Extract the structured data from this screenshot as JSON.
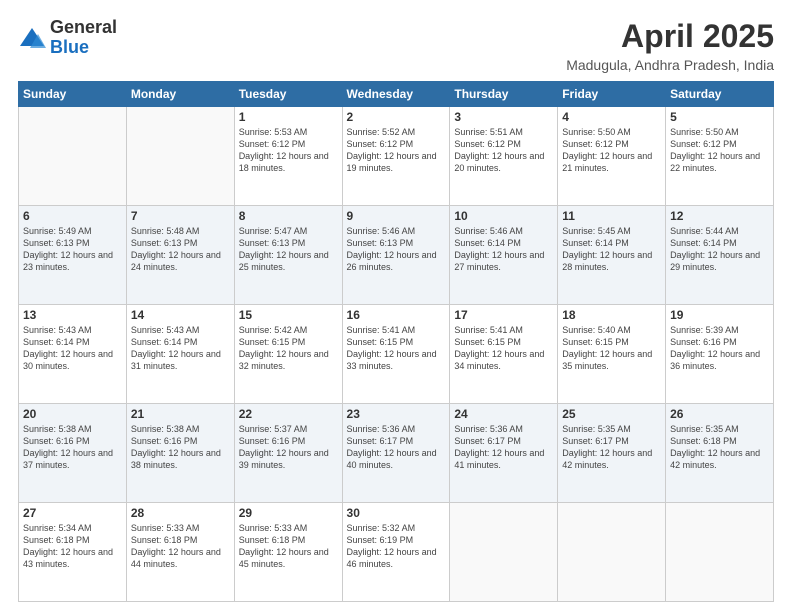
{
  "header": {
    "logo_general": "General",
    "logo_blue": "Blue",
    "title": "April 2025",
    "subtitle": "Madugula, Andhra Pradesh, India"
  },
  "weekdays": [
    "Sunday",
    "Monday",
    "Tuesday",
    "Wednesday",
    "Thursday",
    "Friday",
    "Saturday"
  ],
  "weeks": [
    [
      {
        "day": "",
        "info": ""
      },
      {
        "day": "",
        "info": ""
      },
      {
        "day": "1",
        "info": "Sunrise: 5:53 AM\nSunset: 6:12 PM\nDaylight: 12 hours and 18 minutes."
      },
      {
        "day": "2",
        "info": "Sunrise: 5:52 AM\nSunset: 6:12 PM\nDaylight: 12 hours and 19 minutes."
      },
      {
        "day": "3",
        "info": "Sunrise: 5:51 AM\nSunset: 6:12 PM\nDaylight: 12 hours and 20 minutes."
      },
      {
        "day": "4",
        "info": "Sunrise: 5:50 AM\nSunset: 6:12 PM\nDaylight: 12 hours and 21 minutes."
      },
      {
        "day": "5",
        "info": "Sunrise: 5:50 AM\nSunset: 6:12 PM\nDaylight: 12 hours and 22 minutes."
      }
    ],
    [
      {
        "day": "6",
        "info": "Sunrise: 5:49 AM\nSunset: 6:13 PM\nDaylight: 12 hours and 23 minutes."
      },
      {
        "day": "7",
        "info": "Sunrise: 5:48 AM\nSunset: 6:13 PM\nDaylight: 12 hours and 24 minutes."
      },
      {
        "day": "8",
        "info": "Sunrise: 5:47 AM\nSunset: 6:13 PM\nDaylight: 12 hours and 25 minutes."
      },
      {
        "day": "9",
        "info": "Sunrise: 5:46 AM\nSunset: 6:13 PM\nDaylight: 12 hours and 26 minutes."
      },
      {
        "day": "10",
        "info": "Sunrise: 5:46 AM\nSunset: 6:14 PM\nDaylight: 12 hours and 27 minutes."
      },
      {
        "day": "11",
        "info": "Sunrise: 5:45 AM\nSunset: 6:14 PM\nDaylight: 12 hours and 28 minutes."
      },
      {
        "day": "12",
        "info": "Sunrise: 5:44 AM\nSunset: 6:14 PM\nDaylight: 12 hours and 29 minutes."
      }
    ],
    [
      {
        "day": "13",
        "info": "Sunrise: 5:43 AM\nSunset: 6:14 PM\nDaylight: 12 hours and 30 minutes."
      },
      {
        "day": "14",
        "info": "Sunrise: 5:43 AM\nSunset: 6:14 PM\nDaylight: 12 hours and 31 minutes."
      },
      {
        "day": "15",
        "info": "Sunrise: 5:42 AM\nSunset: 6:15 PM\nDaylight: 12 hours and 32 minutes."
      },
      {
        "day": "16",
        "info": "Sunrise: 5:41 AM\nSunset: 6:15 PM\nDaylight: 12 hours and 33 minutes."
      },
      {
        "day": "17",
        "info": "Sunrise: 5:41 AM\nSunset: 6:15 PM\nDaylight: 12 hours and 34 minutes."
      },
      {
        "day": "18",
        "info": "Sunrise: 5:40 AM\nSunset: 6:15 PM\nDaylight: 12 hours and 35 minutes."
      },
      {
        "day": "19",
        "info": "Sunrise: 5:39 AM\nSunset: 6:16 PM\nDaylight: 12 hours and 36 minutes."
      }
    ],
    [
      {
        "day": "20",
        "info": "Sunrise: 5:38 AM\nSunset: 6:16 PM\nDaylight: 12 hours and 37 minutes."
      },
      {
        "day": "21",
        "info": "Sunrise: 5:38 AM\nSunset: 6:16 PM\nDaylight: 12 hours and 38 minutes."
      },
      {
        "day": "22",
        "info": "Sunrise: 5:37 AM\nSunset: 6:16 PM\nDaylight: 12 hours and 39 minutes."
      },
      {
        "day": "23",
        "info": "Sunrise: 5:36 AM\nSunset: 6:17 PM\nDaylight: 12 hours and 40 minutes."
      },
      {
        "day": "24",
        "info": "Sunrise: 5:36 AM\nSunset: 6:17 PM\nDaylight: 12 hours and 41 minutes."
      },
      {
        "day": "25",
        "info": "Sunrise: 5:35 AM\nSunset: 6:17 PM\nDaylight: 12 hours and 42 minutes."
      },
      {
        "day": "26",
        "info": "Sunrise: 5:35 AM\nSunset: 6:18 PM\nDaylight: 12 hours and 42 minutes."
      }
    ],
    [
      {
        "day": "27",
        "info": "Sunrise: 5:34 AM\nSunset: 6:18 PM\nDaylight: 12 hours and 43 minutes."
      },
      {
        "day": "28",
        "info": "Sunrise: 5:33 AM\nSunset: 6:18 PM\nDaylight: 12 hours and 44 minutes."
      },
      {
        "day": "29",
        "info": "Sunrise: 5:33 AM\nSunset: 6:18 PM\nDaylight: 12 hours and 45 minutes."
      },
      {
        "day": "30",
        "info": "Sunrise: 5:32 AM\nSunset: 6:19 PM\nDaylight: 12 hours and 46 minutes."
      },
      {
        "day": "",
        "info": ""
      },
      {
        "day": "",
        "info": ""
      },
      {
        "day": "",
        "info": ""
      }
    ]
  ]
}
